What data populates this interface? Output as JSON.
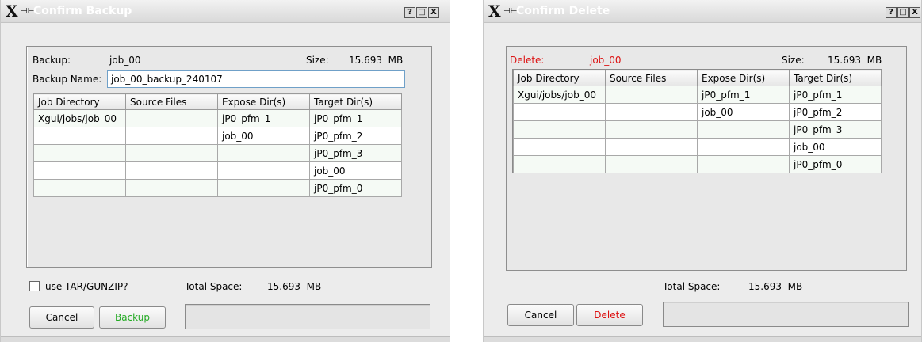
{
  "backup_dialog": {
    "title": "Confirm Backup",
    "titlebar_buttons": [
      "?",
      "□",
      "X"
    ],
    "backup_label": "Backup:",
    "backup_value": "job_00",
    "size_label": "Size:",
    "size_value": "15.693  MB",
    "name_label": "Backup Name:",
    "name_value": "job_00_backup_240107",
    "columns": [
      "Job Directory",
      "Source Files",
      "Expose Dir(s)",
      "Target Dir(s)"
    ],
    "rows": [
      [
        "Xgui/jobs/job_00",
        "",
        "jP0_pfm_1",
        "jP0_pfm_1"
      ],
      [
        "",
        "",
        "job_00",
        "jP0_pfm_2"
      ],
      [
        "",
        "",
        "",
        "jP0_pfm_3"
      ],
      [
        "",
        "",
        "",
        "job_00"
      ],
      [
        "",
        "",
        "",
        "jP0_pfm_0"
      ]
    ],
    "checkbox_label": "use TAR/GUNZIP?",
    "checkbox_checked": false,
    "total_label": "Total Space:",
    "total_value": "15.693  MB",
    "cancel_label": "Cancel",
    "action_label": "Backup",
    "action_color": "#22aa22"
  },
  "delete_dialog": {
    "title": "Confirm Delete",
    "titlebar_buttons": [
      "?",
      "□",
      "X"
    ],
    "delete_label": "Delete:",
    "delete_value": "job_00",
    "label_color": "#dd1111",
    "size_label": "Size:",
    "size_value": "15.693  MB",
    "columns": [
      "Job Directory",
      "Source Files",
      "Expose Dir(s)",
      "Target Dir(s)"
    ],
    "rows": [
      [
        "Xgui/jobs/job_00",
        "",
        "jP0_pfm_1",
        "jP0_pfm_1"
      ],
      [
        "",
        "",
        "job_00",
        "jP0_pfm_2"
      ],
      [
        "",
        "",
        "",
        "jP0_pfm_3"
      ],
      [
        "",
        "",
        "",
        "job_00"
      ],
      [
        "",
        "",
        "",
        "jP0_pfm_0"
      ]
    ],
    "total_label": "Total Space:",
    "total_value": "15.693  MB",
    "cancel_label": "Cancel",
    "action_label": "Delete",
    "action_color": "#dd1111"
  }
}
